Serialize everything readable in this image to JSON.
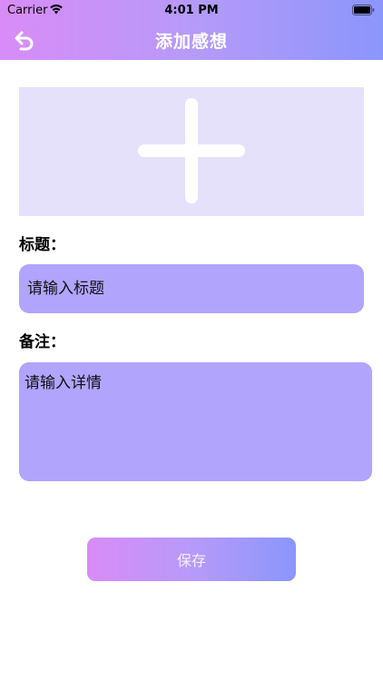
{
  "status_bar": {
    "carrier": "Carrier",
    "time": "4:01 PM"
  },
  "nav": {
    "title": "添加感想",
    "back_icon": "undo-arrow-icon"
  },
  "image_picker": {
    "icon": "plus-icon"
  },
  "form": {
    "title_label": "标题：",
    "title_placeholder": "请输入标题",
    "note_label": "备注：",
    "note_placeholder": "请输入详情"
  },
  "actions": {
    "save_label": "保存"
  },
  "colors": {
    "gradient_start": "#d98cf7",
    "gradient_end": "#8b96fb",
    "field_bg": "#b1a4fd",
    "picker_bg": "#e5e1fb"
  }
}
